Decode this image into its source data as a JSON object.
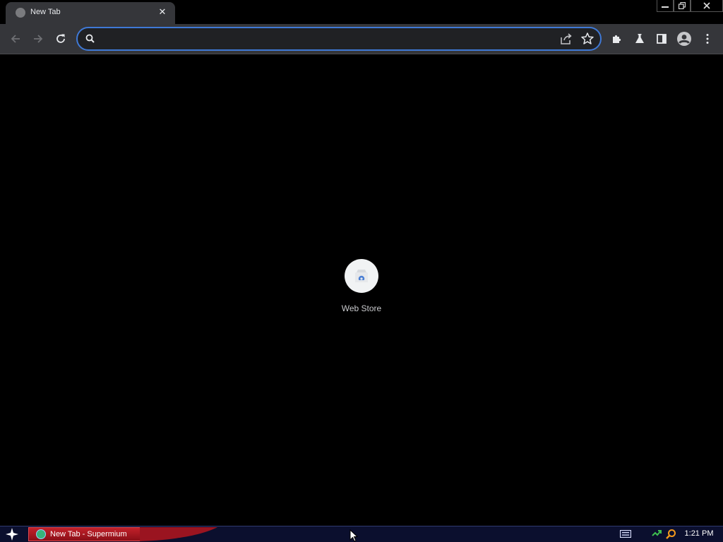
{
  "tab": {
    "title": "New Tab",
    "close_glyph": "✕"
  },
  "window_controls": {
    "minimize": "minimize-icon",
    "restore": "restore-icon",
    "close": "close-icon"
  },
  "toolbar": {
    "back": "back-arrow-icon",
    "forward": "forward-arrow-icon",
    "reload": "reload-icon",
    "omnibox": {
      "value": "",
      "placeholder": ""
    },
    "icons": [
      "share-icon",
      "bookmark-star-icon",
      "extensions-icon",
      "labs-flask-icon",
      "side-panel-icon",
      "profile-avatar-icon",
      "menu-kebab-icon"
    ]
  },
  "ntp": {
    "shortcuts": [
      {
        "label": "Web Store",
        "icon": "web-store-icon"
      }
    ]
  },
  "taskbar": {
    "task_label": "New Tab - Supermium",
    "clock": "1:21 PM",
    "tray_icons": [
      "keyboard-icon",
      "network-icon",
      "search-icon"
    ]
  },
  "colors": {
    "tab_bg": "#35363a",
    "toolbar_bg": "#35363a",
    "omnibox_border": "#3f79d6",
    "content_bg": "#000000",
    "taskbar_bg": "#0b0f2e",
    "task_button": "#c2202a"
  }
}
